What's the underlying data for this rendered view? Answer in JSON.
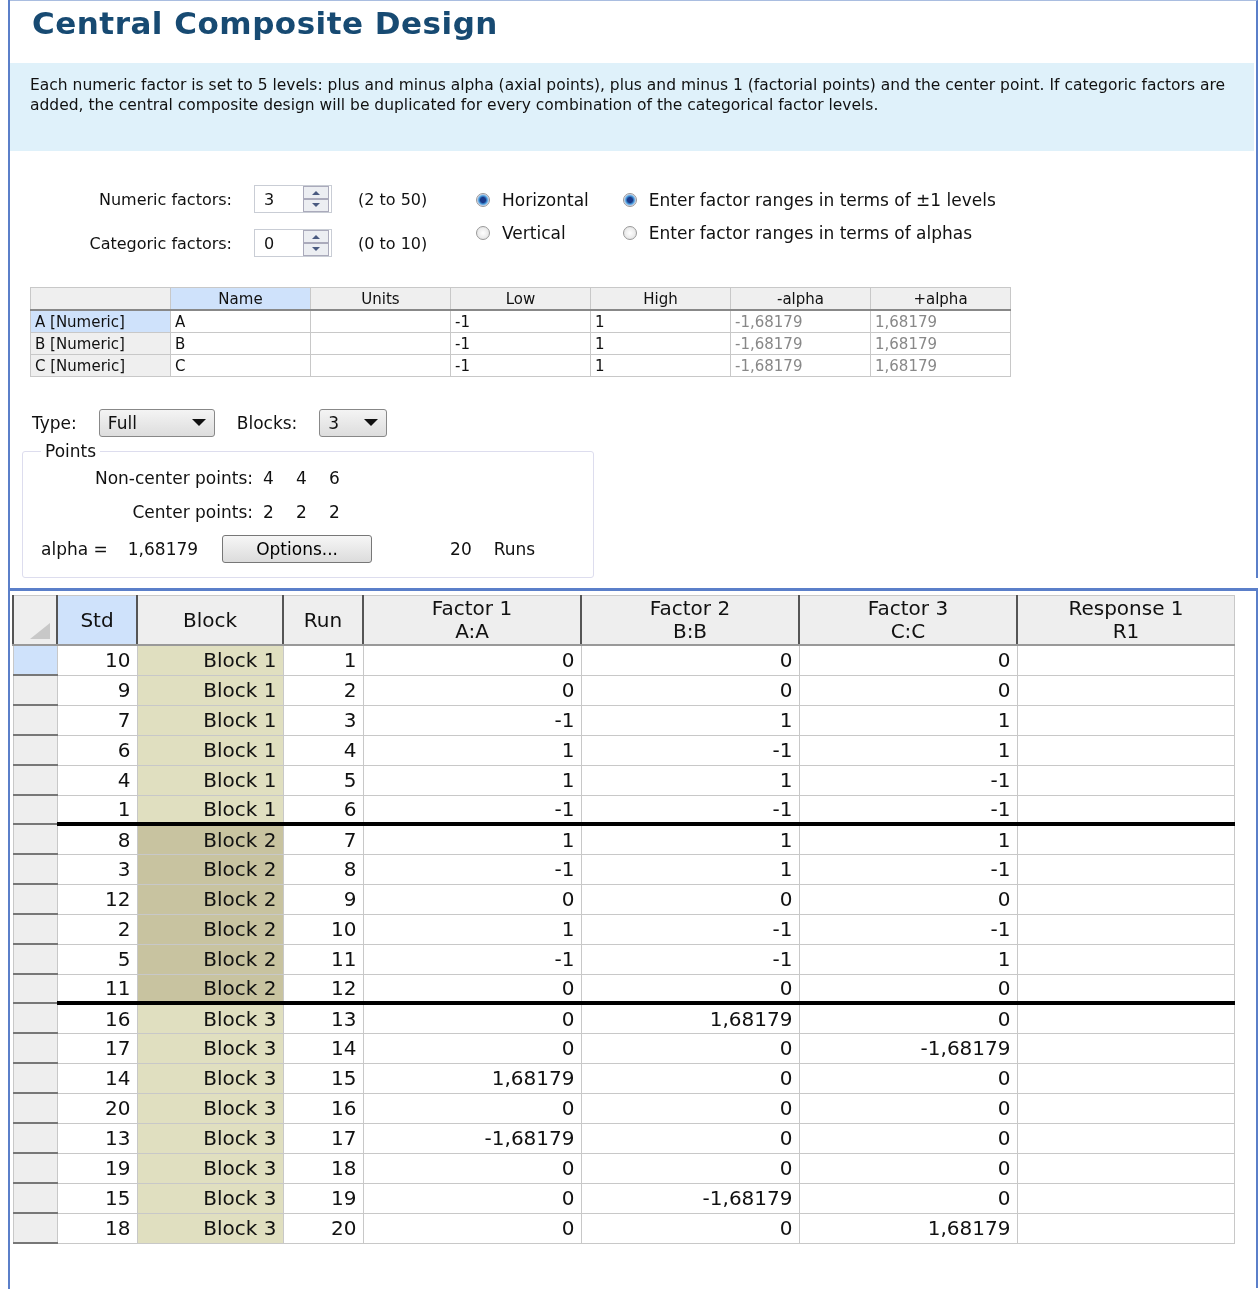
{
  "title": "Central Composite Design",
  "info": "Each numeric factor is set to 5 levels: plus and minus alpha (axial points), plus and minus 1 (factorial points) and the center point. If categoric factors are added, the central composite design will be duplicated for every combination of the categorical factor levels.",
  "spinners": [
    {
      "label": "Numeric factors:",
      "value": "3",
      "range": "(2 to 50)"
    },
    {
      "label": "Categoric factors:",
      "value": "0",
      "range": "(0 to 10)"
    }
  ],
  "layout_options": [
    {
      "label": "Horizontal",
      "selected": true
    },
    {
      "label": "Vertical",
      "selected": false
    }
  ],
  "range_options": [
    {
      "label": "Enter factor ranges in terms of ±1 levels",
      "selected": true
    },
    {
      "label": "Enter factor ranges in terms of alphas",
      "selected": false
    }
  ],
  "factor_table": {
    "columns": [
      {
        "label": "Name",
        "selected": true
      },
      {
        "label": "Units",
        "selected": false
      },
      {
        "label": "Low",
        "selected": false
      },
      {
        "label": "High",
        "selected": false
      },
      {
        "label": "-alpha",
        "selected": false
      },
      {
        "label": "+alpha",
        "selected": false
      }
    ],
    "rows": [
      {
        "label": "A [Numeric]",
        "selected": true,
        "cells": [
          "A",
          "",
          "-1",
          "1",
          "-1,68179",
          "1,68179"
        ]
      },
      {
        "label": "B [Numeric]",
        "selected": false,
        "cells": [
          "B",
          "",
          "-1",
          "1",
          "-1,68179",
          "1,68179"
        ]
      },
      {
        "label": "C [Numeric]",
        "selected": false,
        "cells": [
          "C",
          "",
          "-1",
          "1",
          "-1,68179",
          "1,68179"
        ]
      }
    ]
  },
  "type": {
    "label": "Type:",
    "value": "Full"
  },
  "blocks": {
    "label": "Blocks:",
    "value": "3"
  },
  "points": {
    "title": "Points",
    "non_center_label": "Non-center points:",
    "non_center": [
      "4",
      "4",
      "6"
    ],
    "center_label": "Center points:",
    "center": [
      "2",
      "2",
      "2"
    ],
    "alpha_label": "alpha =",
    "alpha": "1,68179",
    "options_button": "Options...",
    "runs": "20",
    "runs_label": "Runs"
  },
  "grid": {
    "columns": [
      {
        "label": "Std",
        "selected": true
      },
      {
        "label": "Block",
        "selected": false
      },
      {
        "label": "Run",
        "selected": false
      },
      {
        "label": "Factor 1",
        "sub": "A:A",
        "selected": false
      },
      {
        "label": "Factor 2",
        "sub": "B:B",
        "selected": false
      },
      {
        "label": "Factor 3",
        "sub": "C:C",
        "selected": false
      },
      {
        "label": "Response 1",
        "sub": "R1",
        "selected": false
      }
    ],
    "rows": [
      {
        "std": "10",
        "block": "Block 1",
        "run": "1",
        "f1": "0",
        "f2": "0",
        "f3": "0",
        "selected": true,
        "block_end": false,
        "color": "#e0dfc0"
      },
      {
        "std": "9",
        "block": "Block 1",
        "run": "2",
        "f1": "0",
        "f2": "0",
        "f3": "0",
        "selected": false,
        "block_end": false,
        "color": "#e0dfc0"
      },
      {
        "std": "7",
        "block": "Block 1",
        "run": "3",
        "f1": "-1",
        "f2": "1",
        "f3": "1",
        "selected": false,
        "block_end": false,
        "color": "#e0dfc0"
      },
      {
        "std": "6",
        "block": "Block 1",
        "run": "4",
        "f1": "1",
        "f2": "-1",
        "f3": "1",
        "selected": false,
        "block_end": false,
        "color": "#e0dfc0"
      },
      {
        "std": "4",
        "block": "Block 1",
        "run": "5",
        "f1": "1",
        "f2": "1",
        "f3": "-1",
        "selected": false,
        "block_end": false,
        "color": "#e0dfc0"
      },
      {
        "std": "1",
        "block": "Block 1",
        "run": "6",
        "f1": "-1",
        "f2": "-1",
        "f3": "-1",
        "selected": false,
        "block_end": true,
        "color": "#e0dfc0"
      },
      {
        "std": "8",
        "block": "Block 2",
        "run": "7",
        "f1": "1",
        "f2": "1",
        "f3": "1",
        "selected": false,
        "block_end": false,
        "color": "#c8c3a0"
      },
      {
        "std": "3",
        "block": "Block 2",
        "run": "8",
        "f1": "-1",
        "f2": "1",
        "f3": "-1",
        "selected": false,
        "block_end": false,
        "color": "#c8c3a0"
      },
      {
        "std": "12",
        "block": "Block 2",
        "run": "9",
        "f1": "0",
        "f2": "0",
        "f3": "0",
        "selected": false,
        "block_end": false,
        "color": "#c8c3a0"
      },
      {
        "std": "2",
        "block": "Block 2",
        "run": "10",
        "f1": "1",
        "f2": "-1",
        "f3": "-1",
        "selected": false,
        "block_end": false,
        "color": "#c8c3a0"
      },
      {
        "std": "5",
        "block": "Block 2",
        "run": "11",
        "f1": "-1",
        "f2": "-1",
        "f3": "1",
        "selected": false,
        "block_end": false,
        "color": "#c8c3a0"
      },
      {
        "std": "11",
        "block": "Block 2",
        "run": "12",
        "f1": "0",
        "f2": "0",
        "f3": "0",
        "selected": false,
        "block_end": true,
        "color": "#c8c3a0"
      },
      {
        "std": "16",
        "block": "Block 3",
        "run": "13",
        "f1": "0",
        "f2": "1,68179",
        "f3": "0",
        "selected": false,
        "block_end": false,
        "color": "#e0dfc0"
      },
      {
        "std": "17",
        "block": "Block 3",
        "run": "14",
        "f1": "0",
        "f2": "0",
        "f3": "-1,68179",
        "selected": false,
        "block_end": false,
        "color": "#e0dfc0"
      },
      {
        "std": "14",
        "block": "Block 3",
        "run": "15",
        "f1": "1,68179",
        "f2": "0",
        "f3": "0",
        "selected": false,
        "block_end": false,
        "color": "#e0dfc0"
      },
      {
        "std": "20",
        "block": "Block 3",
        "run": "16",
        "f1": "0",
        "f2": "0",
        "f3": "0",
        "selected": false,
        "block_end": false,
        "color": "#e0dfc0"
      },
      {
        "std": "13",
        "block": "Block 3",
        "run": "17",
        "f1": "-1,68179",
        "f2": "0",
        "f3": "0",
        "selected": false,
        "block_end": false,
        "color": "#e0dfc0"
      },
      {
        "std": "19",
        "block": "Block 3",
        "run": "18",
        "f1": "0",
        "f2": "0",
        "f3": "0",
        "selected": false,
        "block_end": false,
        "color": "#e0dfc0"
      },
      {
        "std": "15",
        "block": "Block 3",
        "run": "19",
        "f1": "0",
        "f2": "-1,68179",
        "f3": "0",
        "selected": false,
        "block_end": false,
        "color": "#e0dfc0"
      },
      {
        "std": "18",
        "block": "Block 3",
        "run": "20",
        "f1": "0",
        "f2": "0",
        "f3": "1,68179",
        "selected": false,
        "block_end": false,
        "color": "#e0dfc0"
      }
    ]
  }
}
